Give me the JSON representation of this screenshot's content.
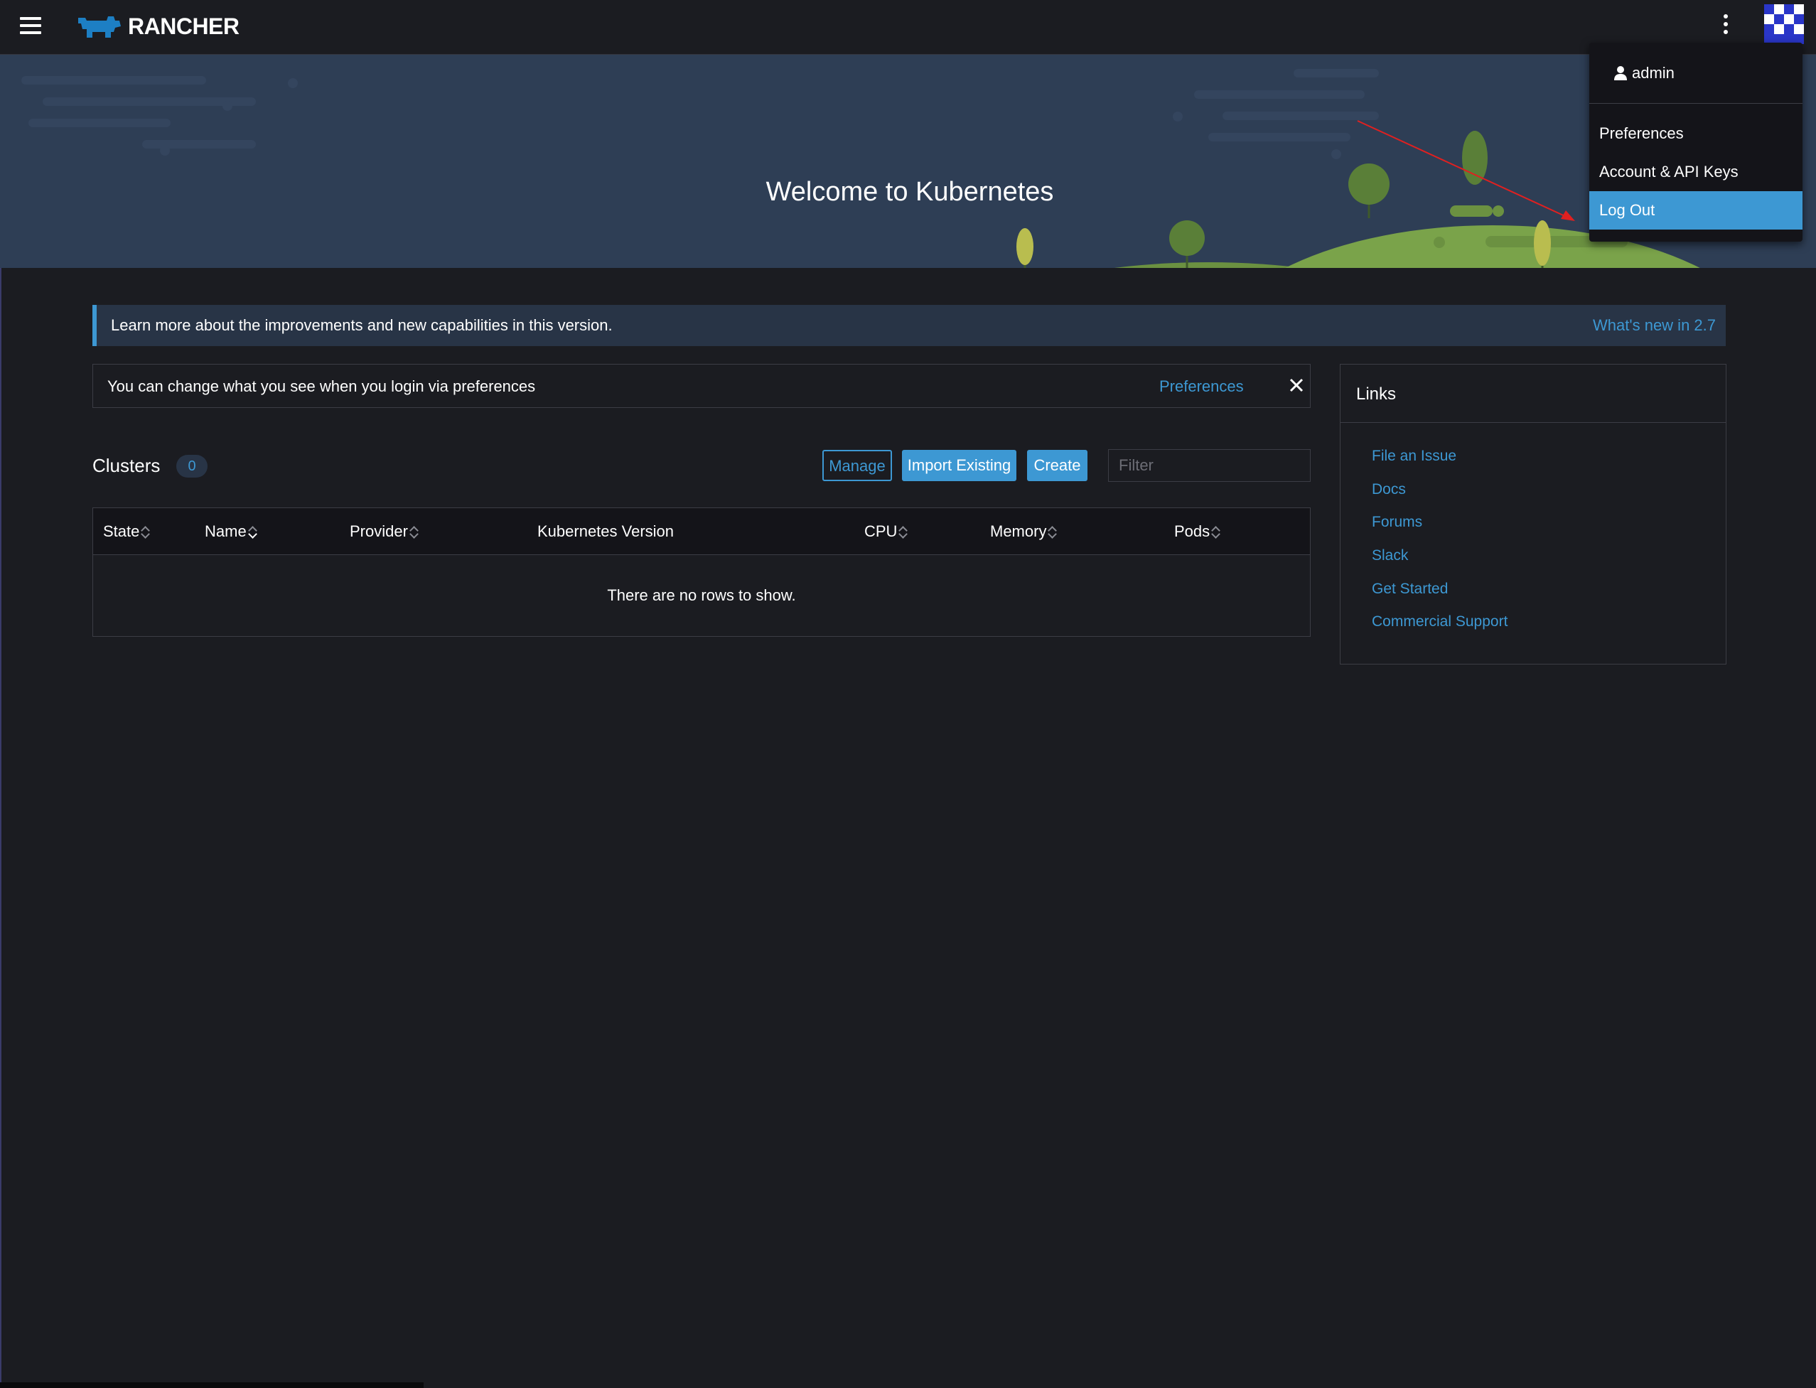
{
  "app": {
    "name": "RANCHER"
  },
  "user_menu": {
    "username": "admin",
    "items": [
      {
        "label": "Preferences"
      },
      {
        "label": "Account & API Keys"
      },
      {
        "label": "Log Out"
      }
    ],
    "active_item": "Log Out"
  },
  "banner": {
    "title": "Welcome to Kubernetes"
  },
  "whats_new": {
    "text": "Learn more about the improvements and new capabilities in this version.",
    "link": "What's new in 2.7"
  },
  "notice": {
    "text": "You can change what you see when you login via preferences",
    "link": "Preferences"
  },
  "clusters": {
    "title": "Clusters",
    "count": "0",
    "buttons": {
      "manage": "Manage",
      "import": "Import Existing",
      "create": "Create"
    },
    "filter_placeholder": "Filter",
    "columns": [
      "State",
      "Name",
      "Provider",
      "Kubernetes Version",
      "CPU",
      "Memory",
      "Pods"
    ],
    "empty_text": "There are no rows to show."
  },
  "links": {
    "title": "Links",
    "items": [
      "File an Issue",
      "Docs",
      "Forums",
      "Slack",
      "Get Started",
      "Commercial Support"
    ]
  },
  "colors": {
    "accent": "#3d98d3",
    "background": "#1b1c21",
    "banner": "#2e3e55",
    "hill": "#7aa34a"
  }
}
